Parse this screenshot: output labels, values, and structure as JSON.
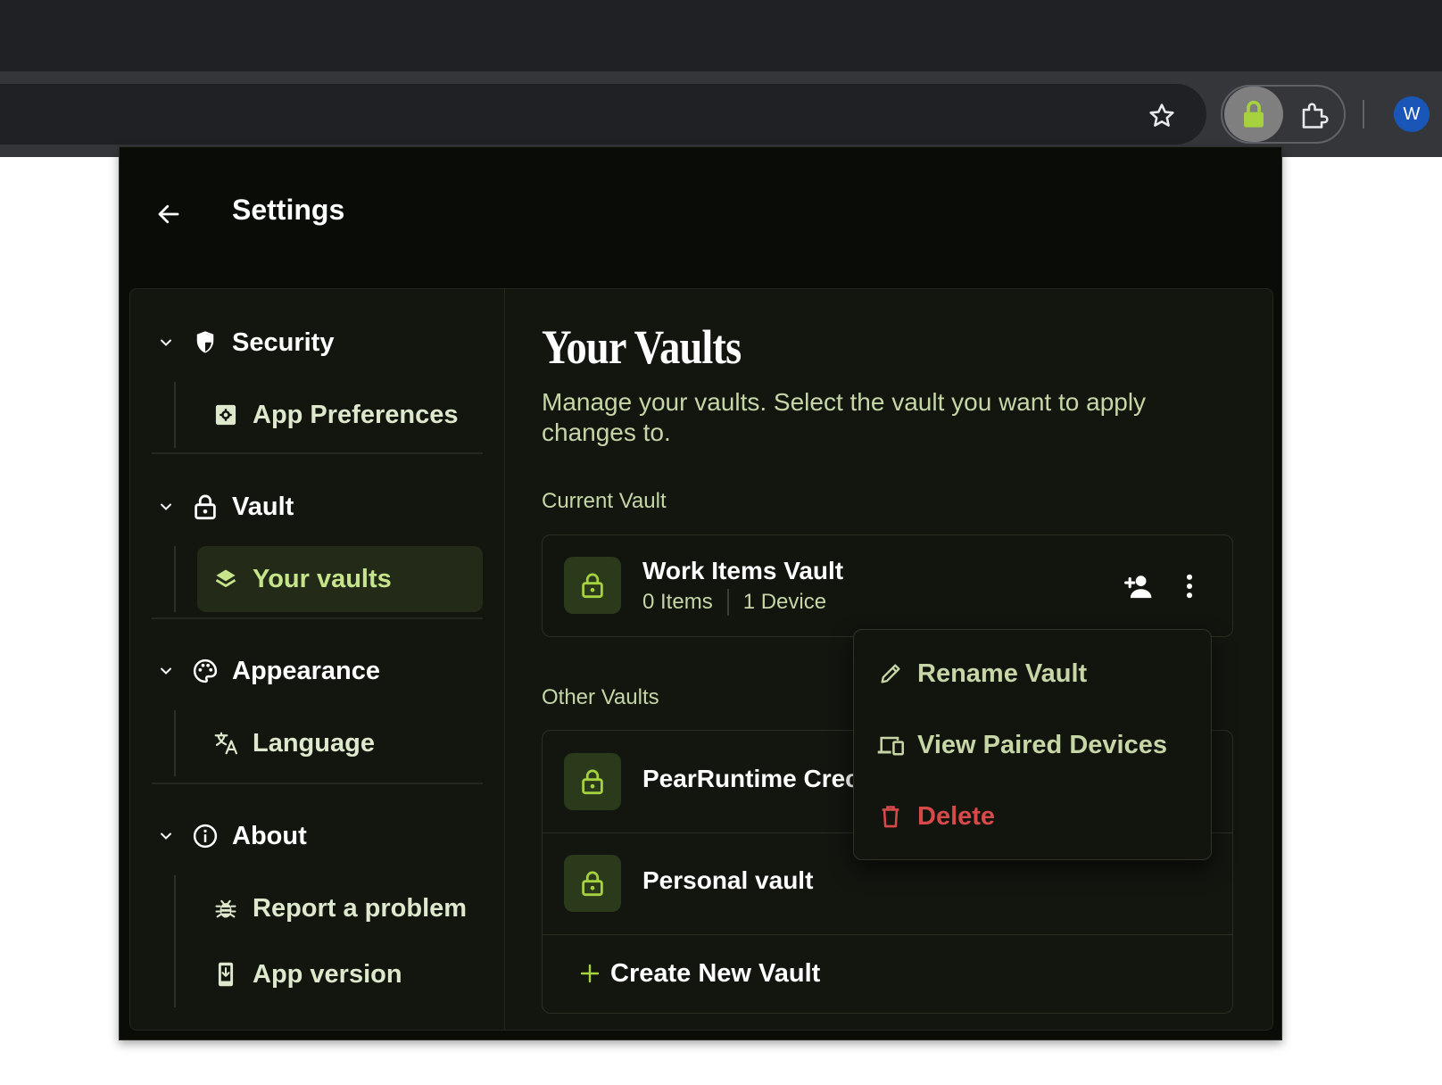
{
  "browser": {
    "profile_initial": "W"
  },
  "colors": {
    "accent": "#c6e58b",
    "danger": "#d84a4a",
    "background": "#0a0c08",
    "panel": "#13150f"
  },
  "header": {
    "title": "Settings"
  },
  "sidebar": {
    "sections": [
      {
        "label": "Security",
        "icon": "shield-icon",
        "items": [
          {
            "label": "App Preferences",
            "icon": "settings-box-icon"
          }
        ]
      },
      {
        "label": "Vault",
        "icon": "lock-icon",
        "items": [
          {
            "label": "Your vaults",
            "icon": "layers-icon",
            "active": true
          }
        ]
      },
      {
        "label": "Appearance",
        "icon": "palette-icon",
        "items": [
          {
            "label": "Language",
            "icon": "translate-icon"
          }
        ]
      },
      {
        "label": "About",
        "icon": "info-icon",
        "items": [
          {
            "label": "Report a problem",
            "icon": "bug-icon"
          },
          {
            "label": "App version",
            "icon": "phone-download-icon"
          }
        ]
      }
    ]
  },
  "main": {
    "title": "Your Vaults",
    "description": "Manage your vaults. Select the vault you want to apply changes to.",
    "current_label": "Current Vault",
    "current_vault": {
      "name": "Work Items Vault",
      "items": "0 Items",
      "devices": "1 Device"
    },
    "other_label": "Other Vaults",
    "other_vaults": [
      {
        "name": "PearRuntime Crec"
      },
      {
        "name": "Personal vault"
      }
    ],
    "create_label": "Create New Vault"
  },
  "context_menu": {
    "items": [
      {
        "label": "Rename Vault",
        "icon": "pencil-icon"
      },
      {
        "label": "View Paired Devices",
        "icon": "devices-icon"
      },
      {
        "label": "Delete",
        "icon": "trash-icon",
        "danger": true
      }
    ]
  }
}
